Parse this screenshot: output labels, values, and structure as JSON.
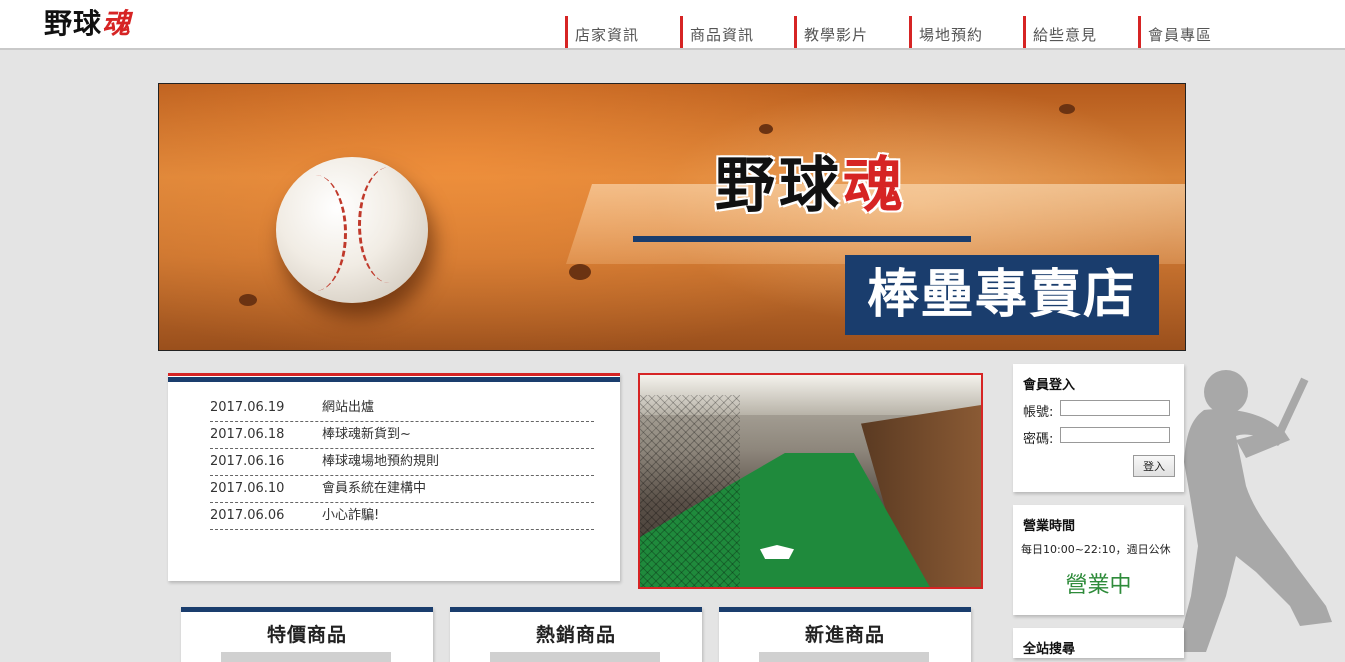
{
  "header": {
    "logo_black": "野球",
    "logo_red": "魂",
    "nav": [
      {
        "label": "店家資訊"
      },
      {
        "label": "商品資訊"
      },
      {
        "label": "教學影片"
      },
      {
        "label": "場地預約"
      },
      {
        "label": "給些意見"
      },
      {
        "label": "會員專區"
      }
    ]
  },
  "banner": {
    "title_black": "野球",
    "title_red": "魂",
    "subtitle": "棒壘專賣店"
  },
  "news": [
    {
      "date": "2017.06.19",
      "title": "網站出爐"
    },
    {
      "date": "2017.06.18",
      "title": "棒球魂新貨到~"
    },
    {
      "date": "2017.06.16",
      "title": "棒球魂場地預約規則"
    },
    {
      "date": "2017.06.10",
      "title": "會員系統在建構中"
    },
    {
      "date": "2017.06.06",
      "title": "小心詐騙!"
    }
  ],
  "login": {
    "title": "會員登入",
    "account_label": "帳號:",
    "password_label": "密碼:",
    "account_value": "",
    "password_value": "",
    "submit": "登入"
  },
  "hours": {
    "title": "營業時間",
    "text": "每日10:00~22:10，週日公休",
    "status": "營業中"
  },
  "search": {
    "title": "全站搜尋"
  },
  "products": [
    {
      "title": "特價商品"
    },
    {
      "title": "熱銷商品"
    },
    {
      "title": "新進商品"
    }
  ],
  "colors": {
    "accent_red": "#d62424",
    "navy": "#1a3d6d",
    "open_green": "#2e8b3a"
  }
}
